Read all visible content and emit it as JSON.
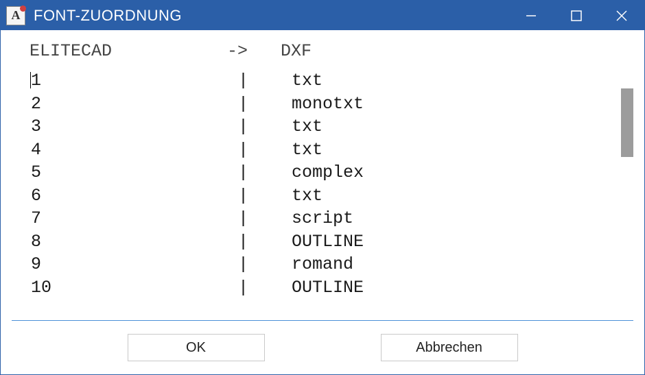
{
  "window": {
    "title": "FONT-ZUORDNUNG",
    "icon_letter": "A"
  },
  "header": {
    "left": "ELITECAD",
    "arrow": "->",
    "right": "DXF"
  },
  "separator": "|",
  "rows": [
    {
      "id": "1",
      "dxf": "txt"
    },
    {
      "id": "2",
      "dxf": "monotxt"
    },
    {
      "id": "3",
      "dxf": "txt"
    },
    {
      "id": "4",
      "dxf": "txt"
    },
    {
      "id": "5",
      "dxf": "complex"
    },
    {
      "id": "6",
      "dxf": "txt"
    },
    {
      "id": "7",
      "dxf": "script"
    },
    {
      "id": "8",
      "dxf": "OUTLINE"
    },
    {
      "id": "9",
      "dxf": "romand"
    },
    {
      "id": "10",
      "dxf": "OUTLINE"
    }
  ],
  "buttons": {
    "ok": "OK",
    "cancel": "Abbrechen"
  }
}
